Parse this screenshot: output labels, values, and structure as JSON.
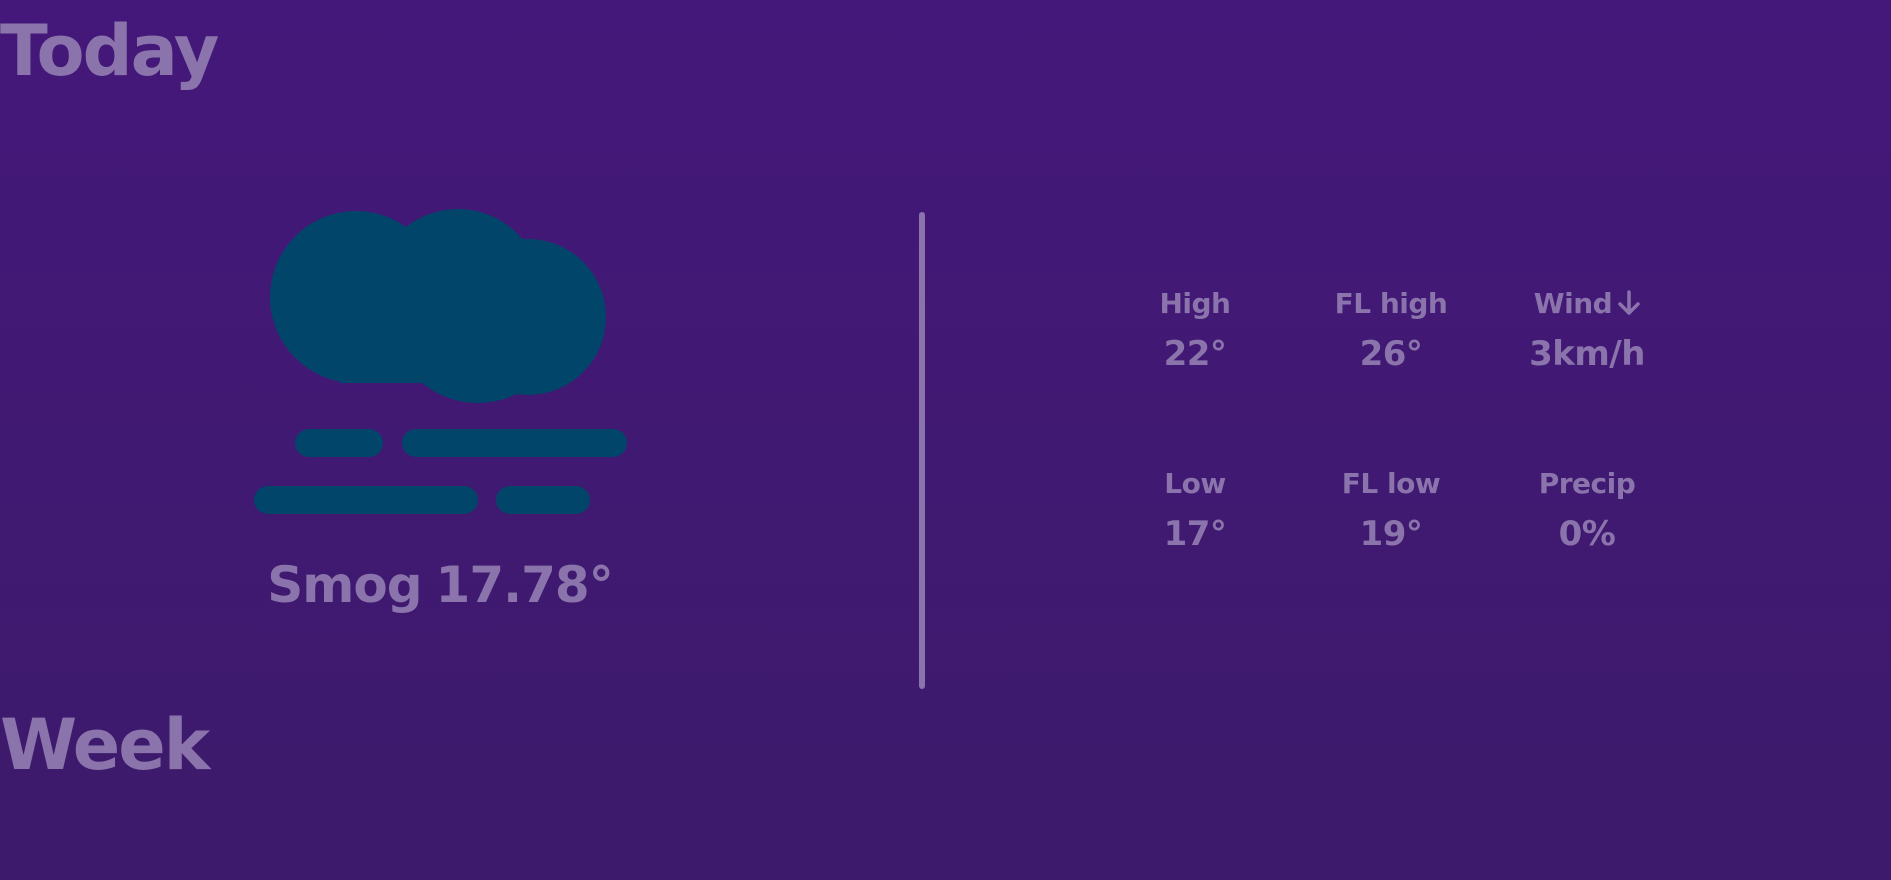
{
  "sections": {
    "today_title": "Today",
    "week_title": "Week"
  },
  "current": {
    "condition": "Smog",
    "temperature": "17.78°",
    "icon": "smog-icon"
  },
  "stats": {
    "high": {
      "label": "High",
      "value": "22°"
    },
    "fl_high": {
      "label": "FL high",
      "value": "26°"
    },
    "wind": {
      "label": "Wind",
      "value": "3km/h",
      "direction_icon": "arrow-down-icon"
    },
    "low": {
      "label": "Low",
      "value": "17°"
    },
    "fl_low": {
      "label": "FL low",
      "value": "19°"
    },
    "precip": {
      "label": "Precip",
      "value": "0%"
    }
  },
  "colors": {
    "background": "#40186f",
    "text": "#8a74ab",
    "icon": "#02456a"
  }
}
